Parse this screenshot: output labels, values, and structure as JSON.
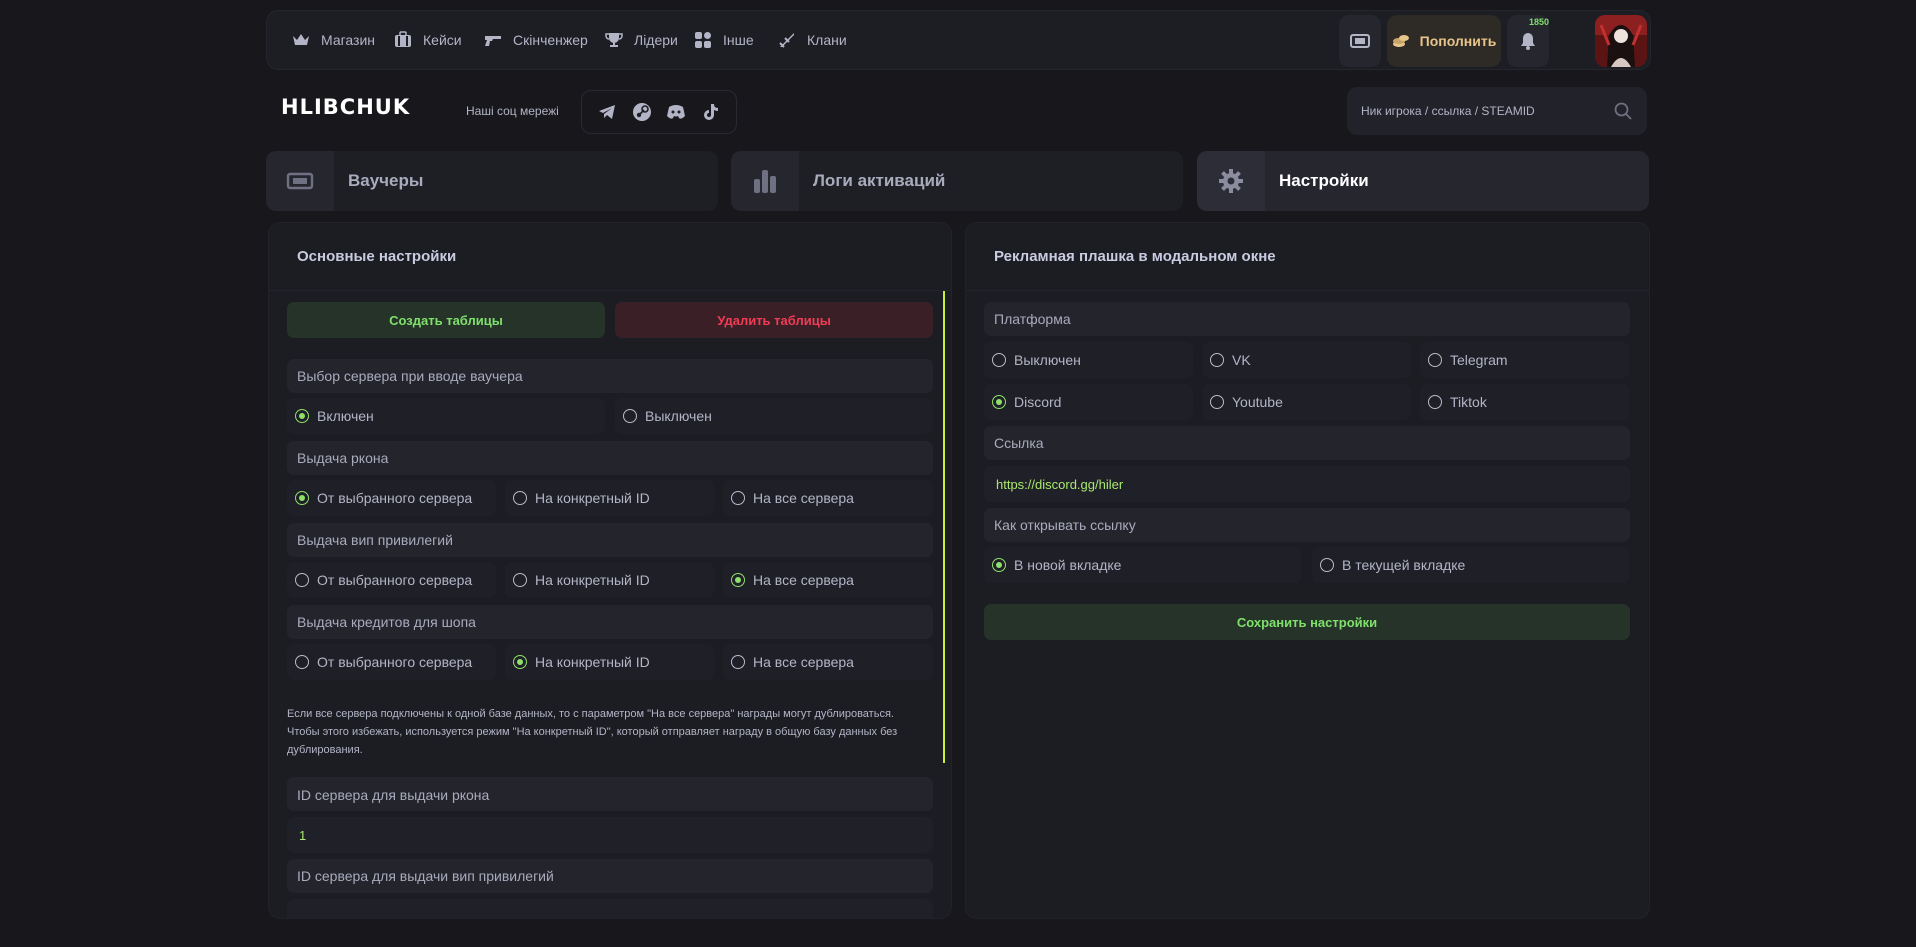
{
  "nav": {
    "items": [
      {
        "label": "Магазин",
        "icon": "crown-icon"
      },
      {
        "label": "Кейси",
        "icon": "case-icon"
      },
      {
        "label": "Скінченжер",
        "icon": "gun-icon"
      },
      {
        "label": "Лідери",
        "icon": "trophy-icon"
      },
      {
        "label": "Інше",
        "icon": "grid-icon"
      },
      {
        "label": "Клани",
        "icon": "swords-icon"
      }
    ],
    "replenish_label": "Пополнить",
    "notification_count": "1850"
  },
  "brand": {
    "logo": "HLIBCHUK",
    "social_label": "Наші соц мережі",
    "socials": [
      "telegram-icon",
      "steam-icon",
      "discord-icon",
      "tiktok-icon"
    ]
  },
  "search": {
    "placeholder": "Ник игрока / ссылка / STEAMID"
  },
  "sections": [
    {
      "label": "Ваучеры",
      "icon": "ticket-icon"
    },
    {
      "label": "Логи активаций",
      "icon": "bars-icon"
    },
    {
      "label": "Настройки",
      "icon": "gear-icon",
      "active": true
    }
  ],
  "left_panel": {
    "title": "Основные настройки",
    "create_label": "Создать таблицы",
    "delete_label": "Удалить таблицы",
    "groups": [
      {
        "label": "Выбор сервера при вводе ваучера",
        "options": [
          "Включен",
          "Выключен"
        ],
        "selected": 0
      },
      {
        "label": "Выдача ркона",
        "options": [
          "От выбранного сервера",
          "На конкретный ID",
          "На все сервера"
        ],
        "selected": 0
      },
      {
        "label": "Выдача вип привилегий",
        "options": [
          "От выбранного сервера",
          "На конкретный ID",
          "На все сервера"
        ],
        "selected": 2
      },
      {
        "label": "Выдача кредитов для шопа",
        "options": [
          "От выбранного сервера",
          "На конкретный ID",
          "На все сервера"
        ],
        "selected": 1
      }
    ],
    "note_line1": "Если все сервера подключены к одной базе данных, то с параметром \"На все сервера\" награды могут дублироваться.",
    "note_line2": "Чтобы этого избежать, используется режим \"На конкретный ID\", который отправляет награду в общую базу данных без",
    "note_line3": "дублирования.",
    "rcon_id_label": "ID сервера для выдачи ркона",
    "rcon_id_value": "1",
    "vip_id_label": "ID сервера для выдачи вип привилегий"
  },
  "right_panel": {
    "title": "Рекламная плашка в модальном окне",
    "platform_label": "Платформа",
    "platforms": [
      "Выключен",
      "VK",
      "Telegram",
      "Discord",
      "Youtube",
      "Tiktok"
    ],
    "platform_selected": 3,
    "link_label": "Ссылка",
    "link_value": "https://discord.gg/hiler",
    "open_label": "Как открывать ссылку",
    "open_options": [
      "В новой вкладке",
      "В текущей вкладке"
    ],
    "open_selected": 0,
    "save_label": "Сохранить настройки"
  },
  "colors": {
    "accent_green": "#7fe06b",
    "danger_red": "#f13c55",
    "scroll_accent": "#c7f234",
    "background": "#17171c"
  }
}
